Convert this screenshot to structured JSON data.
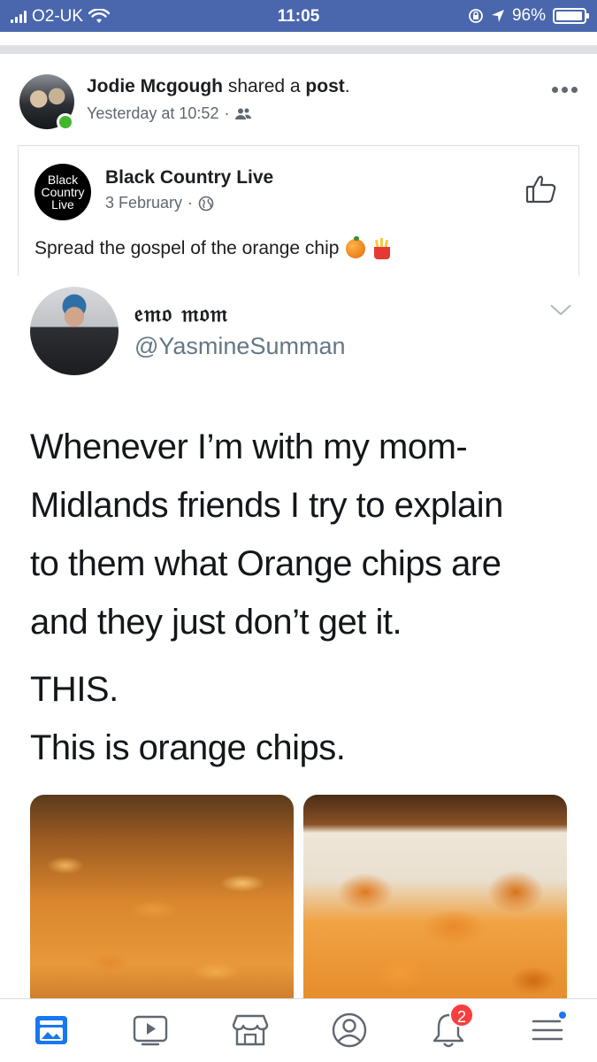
{
  "status_bar": {
    "carrier": "O2-UK",
    "time": "11:05",
    "battery_percent": "96%",
    "battery_level": 0.96,
    "icons": [
      "signal-icon",
      "wifi-icon",
      "rotation-lock-icon",
      "location-icon",
      "battery-icon"
    ]
  },
  "post": {
    "poster_name": "Jodie Mcgough",
    "action_text": "shared a",
    "object_text": "post",
    "punctuation": ".",
    "timestamp": "Yesterday at 10:52",
    "meta_separator": "·",
    "audience_icon": "friends-icon",
    "online": true
  },
  "shared": {
    "page_logo_lines": [
      "Black",
      "Country",
      "Live"
    ],
    "page_name": "Black Country Live",
    "date": "3 February",
    "meta_separator": "·",
    "audience_icon": "globe-icon",
    "text": "Spread the gospel of the orange chip",
    "emojis": [
      "orange-emoji",
      "fries-emoji"
    ]
  },
  "tweet": {
    "display_name": "𝔢𝔪𝔬 𝔪𝔬𝔪",
    "handle": "@YasmineSumman",
    "lines": [
      "Whenever I’m with my mom-",
      "Midlands friends I try to explain",
      "to them what Orange chips are",
      "and they just don’t get it."
    ],
    "lines2": [
      "THIS.",
      "This is orange chips."
    ]
  },
  "bottom_nav": {
    "items": [
      "news-feed-icon",
      "watch-icon",
      "marketplace-icon",
      "profile-icon",
      "notifications-icon",
      "menu-icon"
    ],
    "notification_count": "2"
  },
  "colors": {
    "status_bar": "#4a67ad",
    "online": "#42b72a",
    "badge": "#fa3e3e",
    "active_nav": "#1877f2"
  }
}
